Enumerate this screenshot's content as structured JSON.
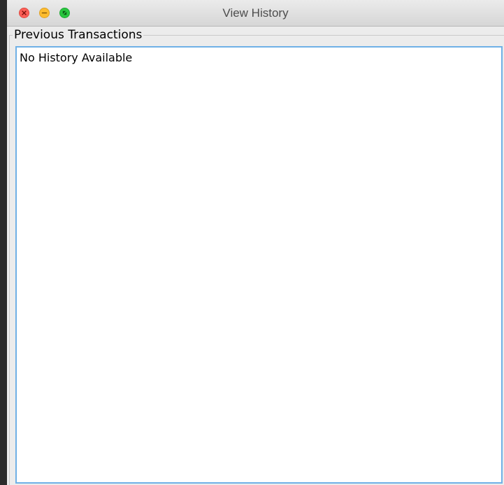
{
  "window": {
    "title": "View History"
  },
  "titlebar": {
    "close_icon": "close-icon",
    "minimize_icon": "minimize-icon",
    "maximize_icon": "fullscreen-icon"
  },
  "panel": {
    "title": "Previous Transactions",
    "content": "No History Available"
  },
  "colors": {
    "close": "#fc5f57",
    "minimize": "#fdbc2e",
    "maximize": "#29c740",
    "focus_border": "#6fb0e6"
  }
}
